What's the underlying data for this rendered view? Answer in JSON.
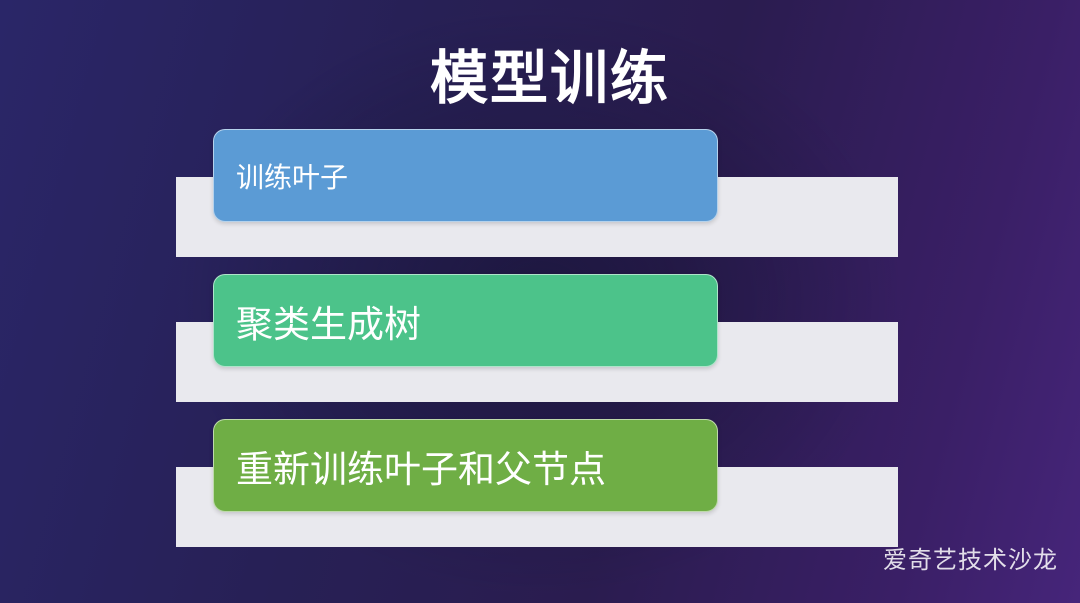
{
  "title": "模型训练",
  "steps": [
    {
      "label": "训练叶子",
      "color": "#5b9bd5"
    },
    {
      "label": "聚类生成树",
      "color": "#4cc38a"
    },
    {
      "label": "重新训练叶子和父节点",
      "color": "#6fae45"
    }
  ],
  "watermark": "爱奇艺技术沙龙"
}
